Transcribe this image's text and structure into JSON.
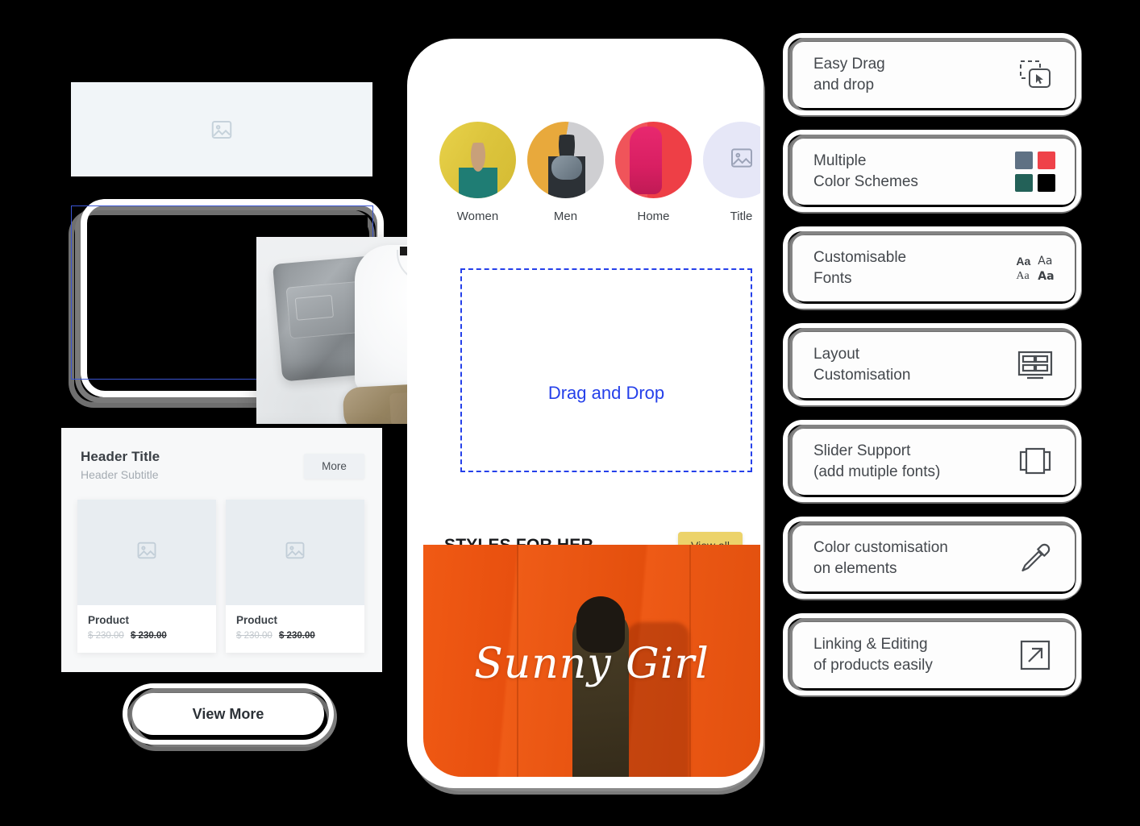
{
  "left_panel": {
    "image_placeholder_icon": "image-icon",
    "selected_panel_icon": "black-panel",
    "garment_photo_alt": "folded-jeans-tshirt-boots",
    "product_section": {
      "header_title": "Header Title",
      "header_subtitle": "Header Subtitle",
      "more_label": "More",
      "products": [
        {
          "name": "Product",
          "price_old": "$ 230.00",
          "price_new": "$ 230.00",
          "image_icon": "image-icon"
        },
        {
          "name": "Product",
          "price_old": "$ 230.00",
          "price_new": "$ 230.00",
          "image_icon": "image-icon"
        }
      ]
    },
    "view_more_label": "View More"
  },
  "phone": {
    "categories": [
      {
        "label": "Women",
        "style": "c-women"
      },
      {
        "label": "Men",
        "style": "c-men"
      },
      {
        "label": "Home",
        "style": "c-home"
      },
      {
        "label": "Title",
        "style": "c-title",
        "icon": "image-icon"
      }
    ],
    "drop_zone": {
      "text": "Drag and Drop",
      "border_color": "#2540ea"
    },
    "styles_section": {
      "title": "STYLES FOR HER",
      "view_all_label": "View all",
      "view_all_color": "#ecd36a"
    },
    "hero": {
      "script_text": "Sunny Girl",
      "background_color": "#e8500f"
    }
  },
  "feature_cards": [
    {
      "line1": "Easy Drag",
      "line2": "and drop",
      "icon": "drag-drop-icon"
    },
    {
      "line1": "Multiple",
      "line2": "Color Schemes",
      "icon": "color-swatches-icon",
      "swatches": [
        "#5f7184",
        "#ef4249",
        "#236158",
        "#000000"
      ]
    },
    {
      "line1": "Customisable",
      "line2": "Fonts",
      "icon": "font-aa-icon",
      "samples": [
        "Aa",
        "Aa",
        "Aa",
        "Aa"
      ]
    },
    {
      "line1": "Layout",
      "line2": "Customisation",
      "icon": "layout-grid-icon"
    },
    {
      "line1": "Slider Support",
      "line2": "(add mutiple fonts)",
      "icon": "carousel-slider-icon"
    },
    {
      "line1": "Color customisation",
      "line2": "on elements",
      "icon": "eyedropper-icon"
    },
    {
      "line1": "Linking & Editing",
      "line2": "of products easily",
      "icon": "external-link-icon"
    }
  ]
}
